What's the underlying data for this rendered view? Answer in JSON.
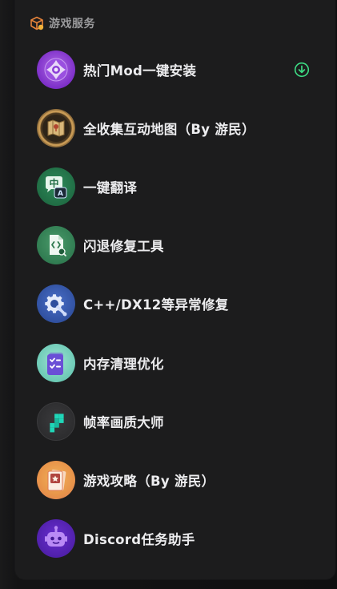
{
  "header": {
    "title": "游戏服务",
    "icon": "package-box-icon"
  },
  "items": [
    {
      "label": "热门Mod一键安装",
      "icon": "mod-install-icon",
      "trailing_icon": "download-circle-icon",
      "trailing_color": "#3ddc84"
    },
    {
      "label": "全收集互动地图（By 游民）",
      "icon": "map-icon"
    },
    {
      "label": "一键翻译",
      "icon": "translate-icon"
    },
    {
      "label": "闪退修复工具",
      "icon": "file-repair-icon"
    },
    {
      "label": "C++/DX12等异常修复",
      "icon": "gear-repair-icon"
    },
    {
      "label": "内存清理优化",
      "icon": "memory-clean-icon"
    },
    {
      "label": "帧率画质大师",
      "icon": "frame-rate-icon"
    },
    {
      "label": "游戏攻略（By 游民）",
      "icon": "guide-book-icon"
    },
    {
      "label": "Discord任务助手",
      "icon": "discord-bot-icon"
    }
  ]
}
